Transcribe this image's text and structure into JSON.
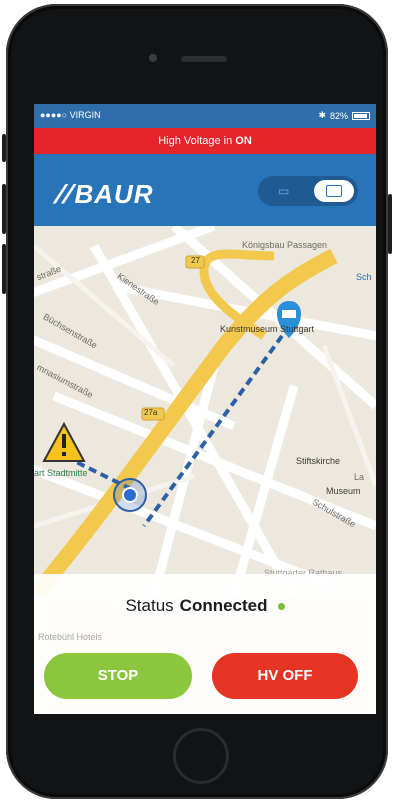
{
  "statusbar": {
    "carrier": "●●●●○ VIRGIN",
    "battery": "82%"
  },
  "alert": {
    "prefix": "High Voltage in ",
    "state": "ON"
  },
  "header": {
    "logo": "BAUR"
  },
  "map": {
    "labels": {
      "konigsbau": "Königsbau Passagen",
      "strasse_top": "straße",
      "kienestrasse": "Kienestraße",
      "buchsenstrasse": "Büchsenstraße",
      "gymnasiumstrasse": "mnasiumstraße",
      "kunstmuseum": "Kunstmuseum Stuttgart",
      "route27": "27",
      "route27a": "27a",
      "stadtmitte": "art Stadtmitte",
      "stiftskirche": "Stiftskirche",
      "museum": "Museum",
      "la": "La",
      "schulstrasse": "Schulstraße",
      "rathaus": "Stuttgarter Rathaus",
      "hotels": "Rotebühl Hotels",
      "sch": "Sch"
    }
  },
  "status": {
    "label": "Status",
    "value": "Connected"
  },
  "buttons": {
    "stop": "STOP",
    "hv_off": "HV OFF"
  },
  "colors": {
    "accent": "#2874b8",
    "alert": "#e4262b",
    "stop": "#8cc63f",
    "hvoff": "#e53424",
    "connected": "#7dbb3c"
  }
}
